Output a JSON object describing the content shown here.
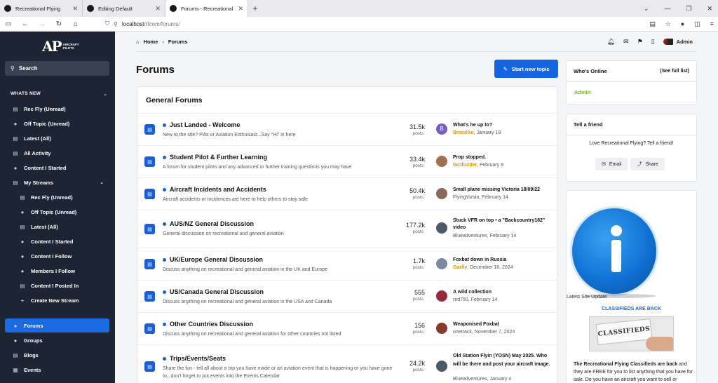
{
  "browser": {
    "tabs": [
      {
        "title": "Recreational Flying",
        "active": false
      },
      {
        "title": "Editing Default",
        "active": false
      },
      {
        "title": "Forums - Recreational Flying",
        "active": true
      }
    ],
    "url_host": "localhost",
    "url_path": "/rfcom/forums/"
  },
  "sidebar": {
    "logo_mark": "AP",
    "logo_text_1": "AIRCRAFT",
    "logo_text_2": "PILOTS",
    "search_label": "Search",
    "section": "WHATS NEW",
    "items": [
      {
        "label": "Rec Fly (Unread)",
        "icon": "list-icon"
      },
      {
        "label": "Off Topic (Unread)",
        "icon": "users-icon"
      },
      {
        "label": "Latest (All)",
        "icon": "list-icon"
      },
      {
        "label": "All Activity",
        "icon": "list-icon"
      },
      {
        "label": "Content I Started",
        "icon": "user-icon"
      },
      {
        "label": "My Streams",
        "icon": "list-icon"
      },
      {
        "label": "Rec Fly (Unread)",
        "icon": "list-icon"
      },
      {
        "label": "Off Topic (Unread)",
        "icon": "users-icon"
      },
      {
        "label": "Latest (All)",
        "icon": "list-icon"
      },
      {
        "label": "Content I Started",
        "icon": "user-icon"
      },
      {
        "label": "Content I Follow",
        "icon": "user-icon"
      },
      {
        "label": "Members I Follow",
        "icon": "users-icon"
      },
      {
        "label": "Content I Posted In",
        "icon": "list-icon"
      },
      {
        "label": "Create New Stream",
        "icon": "plus-icon"
      },
      {
        "label": "Forums",
        "icon": "chat-icon"
      },
      {
        "label": "Groups",
        "icon": "users-icon"
      },
      {
        "label": "Blogs",
        "icon": "book-icon"
      },
      {
        "label": "Events",
        "icon": "calendar-icon"
      }
    ]
  },
  "breadcrumb": {
    "home": "Home",
    "current": "Forums"
  },
  "user": {
    "name": "Admin"
  },
  "page_title": "Forums",
  "start_topic_label": "Start new topic",
  "section_title": "General Forums",
  "posts_label": "posts",
  "forums": [
    {
      "name": "Just Landed - Welcome",
      "desc": "New to the site? Pilot or Aviation Enthusiast...Say \"Hi\" in here",
      "count": "31.5k",
      "last_title": "What's he up to?",
      "last_user": "BrendAn",
      "last_date": "January 19",
      "user_highlight": true,
      "avatar": "#7b5cc4"
    },
    {
      "name": "Student Pilot & Further Learning",
      "desc": "A forum for student pilots and any advanced or further training questions you may have",
      "count": "33.4k",
      "last_title": "Prop stopped.",
      "last_user": "facthunter",
      "last_date": "February 9",
      "user_highlight": true,
      "avatar": "#a07050"
    },
    {
      "name": "Aircraft Incidents and Accidents",
      "desc": "Aircraft accidents or incidences are here to help others to stay safe",
      "count": "50.4k",
      "last_title": "Small plane missing Victoria 18/09/22",
      "last_user": "FlyingVizsla",
      "last_date": "February 14",
      "user_highlight": false,
      "avatar": "#8a6a5a"
    },
    {
      "name": "AUS/NZ General Discussion",
      "desc": "General discussion on recreational and general aviation",
      "count": "177.2k",
      "last_title": "Stuck VFR on top • a \"Backcountry182\" video",
      "last_user": "Blueadventures",
      "last_date": "February 14",
      "user_highlight": false,
      "avatar": "#4a5a6a"
    },
    {
      "name": "UK/Europe General Discussion",
      "desc": "Discuss anything on recreational and general aviation in the UK and Europe",
      "count": "1.7k",
      "last_title": "Foxbat down in Russia",
      "last_user": "Garfly",
      "last_date": "December 16, 2024",
      "user_highlight": true,
      "avatar": "#7a8aa0"
    },
    {
      "name": "US/Canada General Discussion",
      "desc": "Discuss anything on recreational and general aviation in the USA and Canada",
      "count": "555",
      "last_title": "A wild collection",
      "last_user": "red750",
      "last_date": "February 14",
      "user_highlight": false,
      "avatar": "#9a2a3a"
    },
    {
      "name": "Other Countries Discussion",
      "desc": "Discuss anything on recreational and general aviation for other countries not listed",
      "count": "156",
      "last_title": "Weaponised Foxbat",
      "last_user": "onetrack",
      "last_date": "November 7, 2024",
      "user_highlight": false,
      "avatar": "#8a3a2a"
    },
    {
      "name": "Trips/Events/Seats",
      "desc": "Share the fun - tell all about a trip you have made or an aviation event that is happening or you have gone to...don't forget to put events into the Events Calendar",
      "count": "24.2k",
      "last_title": "Old Station Flyin (YOSN) May 2025. Who will be there and post your aircraft image.",
      "last_user": "Blueadventures",
      "last_date": "January 4",
      "user_highlight": false,
      "avatar": "#4a5a6a"
    }
  ],
  "whos_online": {
    "title": "Who's Online",
    "see_full": "(See full list)",
    "users": [
      "Admin"
    ]
  },
  "tell_friend": {
    "title": "Tell a friend",
    "text": "Love Recreational Flying? Tell a friend!",
    "email": "Email",
    "share": "Share"
  },
  "promo": {
    "caption": "Latest Site Update",
    "classifieds_head": "CLASSIFIEDS ARE BACK",
    "classifieds_img_text": "CLASSIFIEDS",
    "body_bold": "The Recreational Flying Classifieds are back",
    "body_rest": " and they are FREE for you to list anything that you have for sale. Do you have an aircraft you want to sell or"
  }
}
